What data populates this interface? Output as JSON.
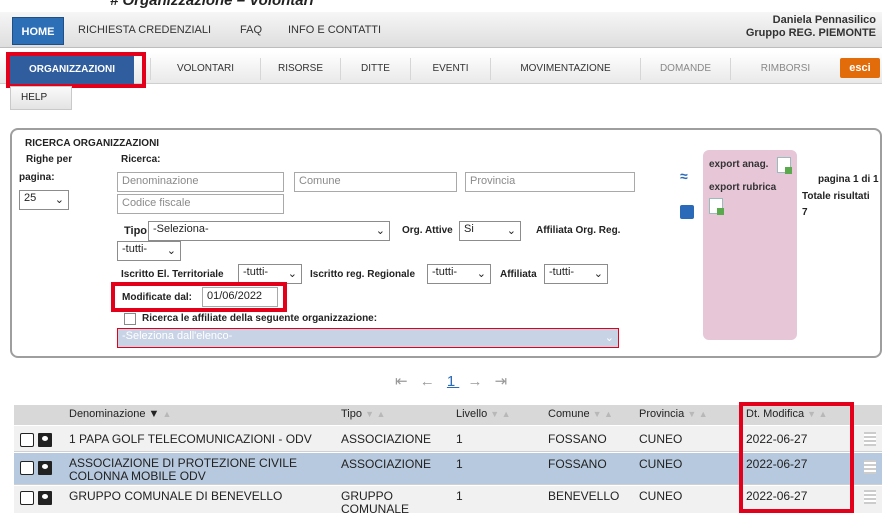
{
  "caption": "# Organizzazione – Volontari",
  "topnav": {
    "home": "HOME",
    "items": [
      "RICHIESTA CREDENZIALI",
      "FAQ",
      "INFO E CONTATTI"
    ],
    "user_name": "Daniela Pennasilico",
    "user_group": "Gruppo REG. PIEMONTE"
  },
  "menu": {
    "active": "ORGANIZZAZIONI",
    "items": [
      "VOLONTARI",
      "RISORSE",
      "DITTE",
      "EVENTI",
      "MOVIMENTAZIONE",
      "DOMANDE",
      "RIMBORSI"
    ],
    "exit": "esci",
    "help": "HELP"
  },
  "search": {
    "title": "RICERCA ORGANIZZAZIONI",
    "rows_label_1": "Righe per",
    "rows_label_2": "pagina:",
    "rows_value": "25",
    "search_label": "Ricerca:",
    "denominazione_placeholder": "Denominazione",
    "comune_placeholder": "Comune",
    "provincia_placeholder": "Provincia",
    "codice_fiscale_placeholder": "Codice fiscale",
    "tipo_label": "Tipo",
    "tipo_value": "-Seleziona-",
    "org_attive_label": "Org. Attive",
    "org_attive_value": "Si",
    "affiliata_org_reg_label": "Affiliata Org. Reg.",
    "affiliata_org_reg_value": "-tutti-",
    "iscritto_terr_label": "Iscritto El. Territoriale",
    "iscritto_terr_value": "-tutti-",
    "iscritto_reg_label": "Iscritto reg. Regionale",
    "iscritto_reg_value": "-tutti-",
    "affiliata_label": "Affiliata",
    "affiliata_value": "-tutti-",
    "modificate_label": "Modificate dal:",
    "modificate_value": "01/06/2022",
    "ricerca_affiliate_label": "Ricerca le affiliate della seguente organizzazione:",
    "seleziona_elenco": "-Seleziona dall'elenco-",
    "export_anag": "export anag.",
    "export_rubrica": "export rubrica",
    "page_info": "pagina 1 di 1",
    "totale_label": "Totale risultati",
    "totale_value": "7"
  },
  "pager": {
    "first": "⇤",
    "prev": "←",
    "current": "1",
    "next": "→",
    "last": "⇥"
  },
  "table": {
    "headers": [
      "Denominazione",
      "Tipo",
      "Livello",
      "Comune",
      "Provincia",
      "Dt. Modifica"
    ],
    "rows": [
      {
        "denominazione": "1 PAPA GOLF TELECOMUNICAZIONI - ODV",
        "tipo": "ASSOCIAZIONE",
        "livello": "1",
        "comune": "FOSSANO",
        "provincia": "CUNEO",
        "dt_modifica": "2022-06-27"
      },
      {
        "denominazione": "ASSOCIAZIONE DI PROTEZIONE CIVILE COLONNA MOBILE ODV",
        "tipo": "ASSOCIAZIONE",
        "livello": "1",
        "comune": "FOSSANO",
        "provincia": "CUNEO",
        "dt_modifica": "2022-06-27"
      },
      {
        "denominazione": "GRUPPO COMUNALE DI BENEVELLO",
        "tipo": "GRUPPO COMUNALE",
        "livello": "1",
        "comune": "BENEVELLO",
        "provincia": "CUNEO",
        "dt_modifica": "2022-06-27"
      }
    ]
  },
  "colors": {
    "highlight_red": "#e3001b",
    "active_blue": "#2f5d9e",
    "row_selected": "#b7c9de",
    "export_pink": "#e7c6d8"
  }
}
